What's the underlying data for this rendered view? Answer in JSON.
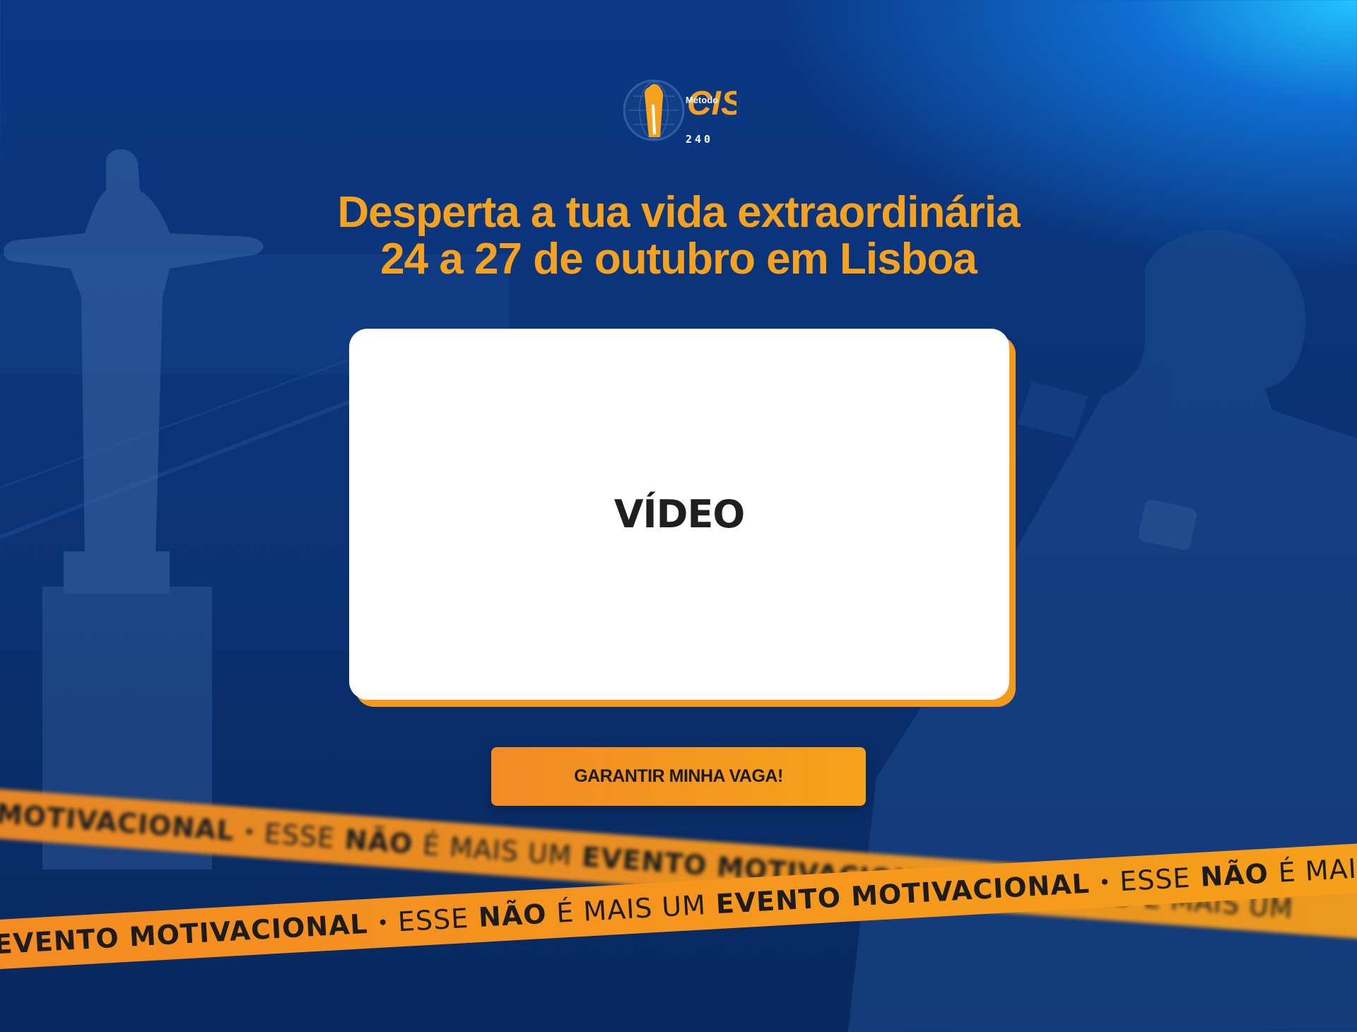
{
  "brand": {
    "logo_script": "Método",
    "logo_main": "CIS",
    "logo_sub": "240"
  },
  "hero": {
    "headline_line1": "Desperta a tua vida extraordinária",
    "headline_line2": "24 a 27 de outubro em Lisboa"
  },
  "video": {
    "label": "VÍDEO"
  },
  "cta": {
    "label": "GARANTIR MINHA VAGA!"
  },
  "ticker": {
    "word_esse": "ESSE",
    "word_nao": "NÃO",
    "word_mais": "É MAIS UM",
    "word_evento": "EVENTO MOTIVACIONAL",
    "separator": "•"
  },
  "colors": {
    "accent": "#f6a21e",
    "background": "#0a3273",
    "card": "#ffffff"
  }
}
